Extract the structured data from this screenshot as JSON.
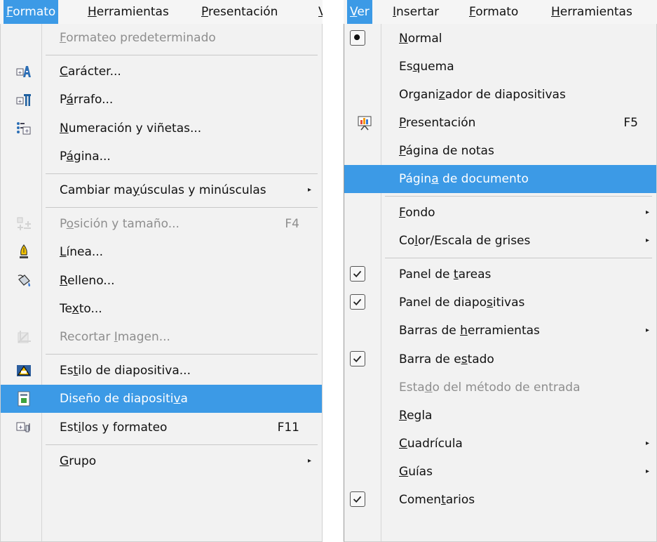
{
  "left": {
    "menubar": [
      {
        "pre": "",
        "key": "F",
        "post": "ormato",
        "active": true
      },
      {
        "pre": "",
        "key": "H",
        "post": "erramientas",
        "active": false
      },
      {
        "pre": "",
        "key": "P",
        "post": "resentación",
        "active": false
      },
      {
        "pre": "",
        "key": "V",
        "post": "e",
        "active": false
      }
    ],
    "items": [
      {
        "pre": "",
        "key": "F",
        "post": "ormateo predeterminado",
        "disabled": true
      },
      {
        "separator": true
      },
      {
        "pre": "",
        "key": "C",
        "post": "arácter...",
        "icon": "character-format-icon"
      },
      {
        "pre": "P",
        "key": "á",
        "post": "rrafo...",
        "icon": "paragraph-icon"
      },
      {
        "pre": "",
        "key": "N",
        "post": "umeración y viñetas...",
        "icon": "numbering-bullets-icon"
      },
      {
        "pre": "P",
        "key": "á",
        "post": "gina..."
      },
      {
        "separator": true
      },
      {
        "pre": "Cambiar ma",
        "key": "y",
        "post": "úsculas y minúsculas",
        "submenu": true
      },
      {
        "separator": true
      },
      {
        "pre": "P",
        "key": "o",
        "post": "sición y tamaño...",
        "shortcut": "F4",
        "disabled": true,
        "icon": "position-size-icon"
      },
      {
        "pre": "",
        "key": "L",
        "post": "ínea...",
        "icon": "line-pen-icon"
      },
      {
        "pre": "",
        "key": "R",
        "post": "elleno...",
        "icon": "fill-bucket-icon"
      },
      {
        "pre": "Te",
        "key": "x",
        "post": "to..."
      },
      {
        "pre": "Recortar ",
        "key": "I",
        "post": "magen...",
        "disabled": true,
        "icon": "crop-image-icon"
      },
      {
        "separator": true
      },
      {
        "pre": "Es",
        "key": "t",
        "post": "ilo de diapositiva...",
        "icon": "slide-style-icon"
      },
      {
        "pre": "Diseño de diapositi",
        "key": "v",
        "post": "a",
        "selected": true,
        "icon": "slide-layout-icon"
      },
      {
        "pre": "Est",
        "key": "i",
        "post": "los y formateo",
        "shortcut": "F11",
        "icon": "styles-formatting-icon"
      },
      {
        "separator": true
      },
      {
        "pre": "",
        "key": "G",
        "post": "rupo",
        "submenu": true
      }
    ]
  },
  "right": {
    "menubar": [
      {
        "pre": "",
        "key": "V",
        "post": "er",
        "active": true
      },
      {
        "pre": "",
        "key": "I",
        "post": "nsertar",
        "active": false
      },
      {
        "pre": "",
        "key": "F",
        "post": "ormato",
        "active": false
      },
      {
        "pre": "",
        "key": "H",
        "post": "erramientas",
        "active": false
      }
    ],
    "items": [
      {
        "pre": "",
        "key": "N",
        "post": "ormal",
        "radio": true
      },
      {
        "pre": "Es",
        "key": "q",
        "post": "uema"
      },
      {
        "pre": "Organi",
        "key": "z",
        "post": "ador de diapositivas"
      },
      {
        "pre": "",
        "key": "P",
        "post": "resentación",
        "shortcut": "F5",
        "icon": "presentation-icon"
      },
      {
        "pre": "",
        "key": "P",
        "post": "ágina de notas"
      },
      {
        "pre": "Págin",
        "key": "a",
        "post": " de documento",
        "selected": true
      },
      {
        "separator": true
      },
      {
        "pre": "",
        "key": "F",
        "post": "ondo",
        "submenu": true
      },
      {
        "pre": "Co",
        "key": "l",
        "post": "or/Escala de grises",
        "submenu": true
      },
      {
        "separator": true
      },
      {
        "pre": "Panel de ",
        "key": "t",
        "post": "areas",
        "checked": true
      },
      {
        "pre": "Panel de diapo",
        "key": "s",
        "post": "itivas",
        "checked": true
      },
      {
        "pre": "Barras de ",
        "key": "h",
        "post": "erramientas",
        "submenu": true
      },
      {
        "pre": "Barra de e",
        "key": "s",
        "post": "tado",
        "checked": true
      },
      {
        "pre": "Esta",
        "key": "d",
        "post": "o del método de entrada",
        "disabled": true
      },
      {
        "pre": "",
        "key": "R",
        "post": "egla"
      },
      {
        "pre": "",
        "key": "C",
        "post": "uadrícula",
        "submenu": true
      },
      {
        "pre": "",
        "key": "G",
        "post": "uías",
        "submenu": true
      },
      {
        "pre": "Comen",
        "key": "t",
        "post": "arios",
        "checked": true
      }
    ]
  },
  "colors": {
    "highlight": "#3c9ae6",
    "disabled": "#8e8e8e"
  }
}
